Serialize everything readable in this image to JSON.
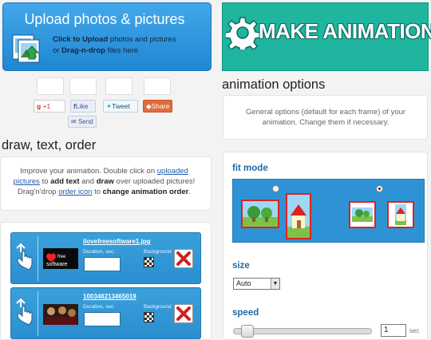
{
  "upload": {
    "title": "Upload photos & pictures",
    "hint_bold_1": "Click to Upload",
    "hint_text_1": " photos and pictures",
    "hint_text_2": "or ",
    "hint_bold_2": "Drag-n-drop",
    "hint_text_3": " files here"
  },
  "banner": {
    "title": "MAKE ANIMATION"
  },
  "social": {
    "gplus_label": "+1",
    "fb_like_label": "Like",
    "tweet_label": "Tweet",
    "share_label": "Share",
    "send_label": "Send"
  },
  "draw": {
    "heading": "draw, text, order",
    "info_1": "Improve your animation. Double click on ",
    "info_link_1": "uploaded pictures",
    "info_2": " to ",
    "info_bold_1": "add text",
    "info_3": " and ",
    "info_bold_2": "draw",
    "info_4": " over uploaded pictures! Drag'n'drop ",
    "info_link_2": "order icon",
    "info_5": " to ",
    "info_bold_3": "change animation order",
    "info_6": "."
  },
  "frames": [
    {
      "name": "ilovefreesoftware1.jpg",
      "duration_label": "Duration, sec.",
      "background_label": "Background",
      "duration_value": ""
    },
    {
      "name": "100348213465019",
      "duration_label": "Duration, sec.",
      "background_label": "Background",
      "duration_value": ""
    }
  ],
  "options": {
    "heading": "animation options",
    "info": "General options (default for each frame) of your animation. Change them if necessary.",
    "fitmode_label": "fit mode",
    "size_label": "size",
    "size_value": "Auto",
    "speed_label": "speed",
    "speed_value": "1",
    "speed_unit": "sec"
  },
  "colors": {
    "upload_blue": "#2a93dc",
    "banner_teal": "#1fb59e",
    "option_label": "#1f6aa5",
    "delete_red": "#cc2222"
  }
}
